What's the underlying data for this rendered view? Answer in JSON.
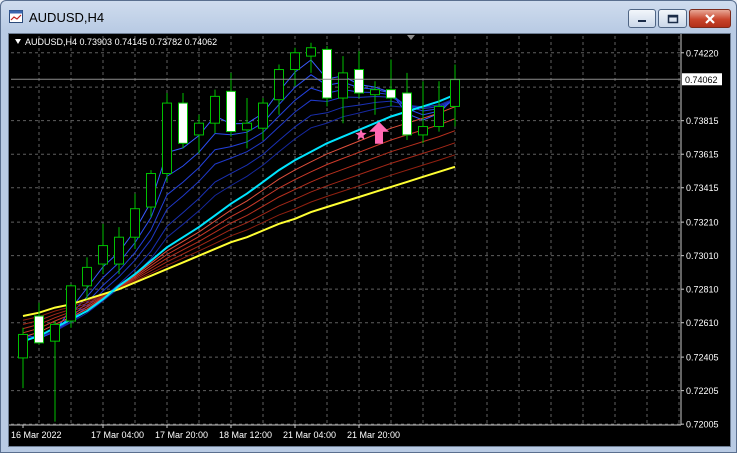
{
  "window": {
    "title": "AUDUSD,H4",
    "icons": {
      "app": "chart-window-icon",
      "minimize": "minimize-icon",
      "maximize": "maximize-icon",
      "close": "close-icon"
    }
  },
  "chart": {
    "symbol_label": "AUDUSD,H4",
    "ohlc_label": "0.73903 0.74145 0.73782 0.74062",
    "current_price_label": "0.74062",
    "current_price": 0.74062,
    "colors": {
      "background": "#000000",
      "grid": "#5f5f5f",
      "bull_candle": "#00c000",
      "bear_candle_body": "#ffffff",
      "price_line": "#8c8c8c",
      "signal_star": "#ff69b4",
      "signal_arrow": "#ff69b4",
      "fast_ma_edge": "#00e5ff",
      "slow_ma_edge": "#ffff33",
      "fast_ma_group": "#1e3cff",
      "slow_ma_group": "#c0281e"
    },
    "signal": {
      "type": "buy",
      "arrow_icon": "up-arrow-icon",
      "marker_icon": "star-icon",
      "candle_index": 22
    }
  },
  "chart_data": {
    "type": "candlestick",
    "title": "AUDUSD,H4",
    "ylim": [
      0.72,
      0.7432
    ],
    "price_ticks": [
      "0.74220",
      "0.74015",
      "0.73815",
      "0.73615",
      "0.73415",
      "0.73210",
      "0.73010",
      "0.72810",
      "0.72610",
      "0.72405",
      "0.72205",
      "0.72005"
    ],
    "time_labels": [
      {
        "label": "16 Mar 2022",
        "candle": 0
      },
      {
        "label": "17 Mar 04:00",
        "candle": 5
      },
      {
        "label": "17 Mar 20:00",
        "candle": 9
      },
      {
        "label": "18 Mar 12:00",
        "candle": 13
      },
      {
        "label": "21 Mar 04:00",
        "candle": 17
      },
      {
        "label": "21 Mar 20:00",
        "candle": 21
      }
    ],
    "candles": [
      {
        "o": 0.724,
        "h": 0.7258,
        "l": 0.7222,
        "c": 0.7254
      },
      {
        "o": 0.7265,
        "h": 0.7273,
        "l": 0.7248,
        "c": 0.7249
      },
      {
        "o": 0.725,
        "h": 0.7262,
        "l": 0.7202,
        "c": 0.726
      },
      {
        "o": 0.7262,
        "h": 0.7284,
        "l": 0.7258,
        "c": 0.7283
      },
      {
        "o": 0.7283,
        "h": 0.73,
        "l": 0.7275,
        "c": 0.7294
      },
      {
        "o": 0.7296,
        "h": 0.732,
        "l": 0.729,
        "c": 0.7307
      },
      {
        "o": 0.7296,
        "h": 0.7318,
        "l": 0.729,
        "c": 0.7312
      },
      {
        "o": 0.7312,
        "h": 0.7338,
        "l": 0.7305,
        "c": 0.7329
      },
      {
        "o": 0.733,
        "h": 0.7352,
        "l": 0.7324,
        "c": 0.735
      },
      {
        "o": 0.735,
        "h": 0.7398,
        "l": 0.7345,
        "c": 0.7392
      },
      {
        "o": 0.7392,
        "h": 0.7398,
        "l": 0.7365,
        "c": 0.7368
      },
      {
        "o": 0.7373,
        "h": 0.7385,
        "l": 0.7362,
        "c": 0.738
      },
      {
        "o": 0.738,
        "h": 0.74,
        "l": 0.7374,
        "c": 0.7396
      },
      {
        "o": 0.7399,
        "h": 0.741,
        "l": 0.7372,
        "c": 0.7375
      },
      {
        "o": 0.7376,
        "h": 0.7395,
        "l": 0.7365,
        "c": 0.738
      },
      {
        "o": 0.7377,
        "h": 0.7395,
        "l": 0.737,
        "c": 0.7392
      },
      {
        "o": 0.7394,
        "h": 0.7415,
        "l": 0.7385,
        "c": 0.7412
      },
      {
        "o": 0.7412,
        "h": 0.7425,
        "l": 0.7402,
        "c": 0.7422
      },
      {
        "o": 0.742,
        "h": 0.7428,
        "l": 0.741,
        "c": 0.7425
      },
      {
        "o": 0.7424,
        "h": 0.7426,
        "l": 0.739,
        "c": 0.7395
      },
      {
        "o": 0.7395,
        "h": 0.742,
        "l": 0.738,
        "c": 0.741
      },
      {
        "o": 0.7412,
        "h": 0.7423,
        "l": 0.7395,
        "c": 0.7398
      },
      {
        "o": 0.7397,
        "h": 0.7405,
        "l": 0.7385,
        "c": 0.74
      },
      {
        "o": 0.74,
        "h": 0.7418,
        "l": 0.739,
        "c": 0.7395
      },
      {
        "o": 0.7398,
        "h": 0.741,
        "l": 0.737,
        "c": 0.7373
      },
      {
        "o": 0.7373,
        "h": 0.7405,
        "l": 0.7368,
        "c": 0.7378
      },
      {
        "o": 0.7378,
        "h": 0.7405,
        "l": 0.7375,
        "c": 0.739
      },
      {
        "o": 0.739,
        "h": 0.7415,
        "l": 0.7378,
        "c": 0.7406
      }
    ],
    "moving_averages": {
      "fast_group_color": "#1e3cff",
      "slow_group_color": "#c0281e",
      "fast_edge_color": "#00e5ff",
      "slow_edge_color": "#ffff33",
      "fast_edge": [
        0.725,
        0.7253,
        0.7258,
        0.7263,
        0.7268,
        0.7275,
        0.7283,
        0.729,
        0.7298,
        0.7306,
        0.7312,
        0.7318,
        0.7325,
        0.7332,
        0.7338,
        0.7345,
        0.7352,
        0.7358,
        0.7363,
        0.7368,
        0.7372,
        0.7376,
        0.738,
        0.7384,
        0.7387,
        0.739,
        0.7393,
        0.7397
      ],
      "slow_edge": [
        0.7265,
        0.7267,
        0.727,
        0.7272,
        0.7275,
        0.7278,
        0.7281,
        0.7285,
        0.7289,
        0.7293,
        0.7297,
        0.7301,
        0.7305,
        0.7309,
        0.7312,
        0.7316,
        0.732,
        0.7323,
        0.7327,
        0.733,
        0.7333,
        0.7336,
        0.7339,
        0.7342,
        0.7345,
        0.7348,
        0.7351,
        0.7354
      ]
    }
  }
}
